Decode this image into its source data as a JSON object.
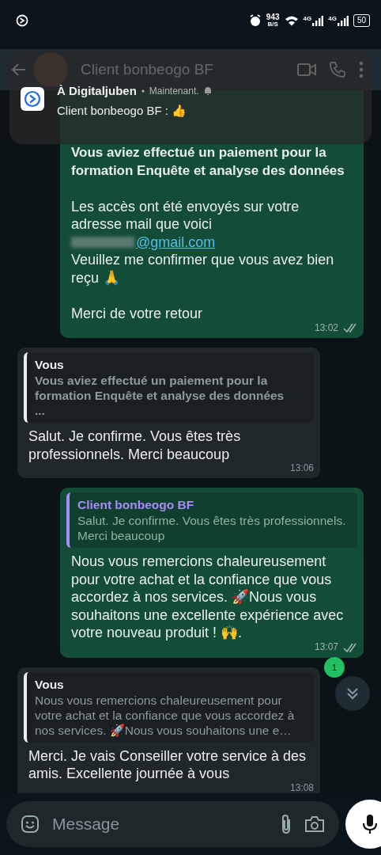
{
  "status_bar": {
    "speed": "943",
    "speed_unit": "B/S",
    "networks": [
      "4G",
      "4G"
    ],
    "battery": "50"
  },
  "header": {
    "title": "Client bonbeogo BF"
  },
  "notification": {
    "app": "À Digitaljuben",
    "time": "Maintenant.",
    "text": "Client bonbeogo BF : 👍"
  },
  "messages": [
    {
      "kind": "outgoing",
      "read": false,
      "time": "13:02",
      "parts": [
        {
          "kind": "bold",
          "text": "Vous aviez effectué un paiement pour la formation Enquête et analyse des données"
        },
        {
          "kind": "gap"
        },
        {
          "kind": "text",
          "text": "Les accès ont été envoyés sur votre adresse mail que voici"
        },
        {
          "kind": "email",
          "text": "@gmail.com"
        },
        {
          "kind": "text",
          "text": "Veuillez me confirmer que vous avez bien reçu 🙏"
        },
        {
          "kind": "gap"
        },
        {
          "kind": "text",
          "text": "Merci de votre retour"
        }
      ]
    },
    {
      "kind": "incoming",
      "time": "13:06",
      "quote": {
        "author": "Vous",
        "color": "#e9edef",
        "text": "Vous aviez effectué un paiement pour la formation Enquête et analyse des données\n...",
        "bold": true
      },
      "parts": [
        {
          "kind": "text",
          "text": "Salut. Je confirme. Vous êtes très professionnels. Merci beaucoup"
        }
      ]
    },
    {
      "kind": "outgoing",
      "read": false,
      "time": "13:07",
      "quote": {
        "author": "Client bonbeogo BF",
        "color": "#a78bfa",
        "text": "Salut. Je confirme. Vous êtes très professionnels. Merci beaucoup",
        "bold": false
      },
      "parts": [
        {
          "kind": "text",
          "text": "Nous vous remercions chaleureusement pour votre achat et la confiance que vous accordez à nos services. 🚀Nous vous souhaitons une excellente expérience avec votre nouveau produit ! 🙌."
        }
      ]
    },
    {
      "kind": "incoming",
      "time": "13:08",
      "quote": {
        "author": "Vous",
        "color": "#e9edef",
        "text": "Nous vous remercions chaleureusement pour votre achat et la confiance que vous accordez à nos services. 🚀Nous vous souhaitons une e…",
        "bold": false
      },
      "parts": [
        {
          "kind": "text",
          "text": "Merci. Je vais Conseiller votre service à des amis. Excellente journée à vous"
        }
      ]
    }
  ],
  "scroll_button": {
    "badge": "1"
  },
  "composer": {
    "placeholder": "Message"
  }
}
